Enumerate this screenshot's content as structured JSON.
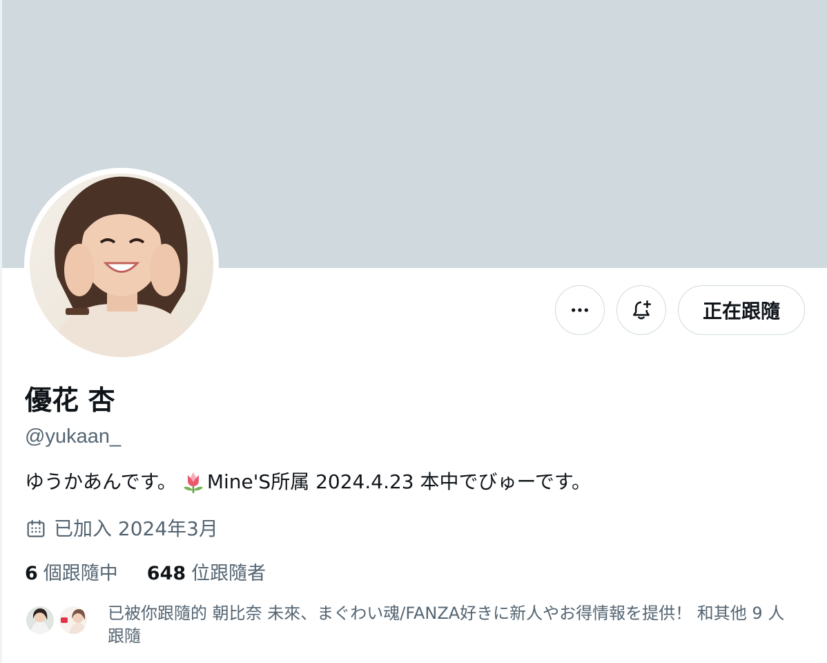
{
  "profile": {
    "display_name": "優花 杏",
    "handle": "@yukaan_",
    "bio_before": "ゆうかあんです。",
    "bio_emoji": "tulip-icon",
    "bio_after": "Mine'S所属 2024.4.23 本中でびゅーです。",
    "joined": "已加入 2024年3月"
  },
  "actions": {
    "more_icon": "more-icon",
    "notify_icon": "bell-plus-icon",
    "follow_label": "正在跟隨"
  },
  "stats": {
    "following_count": "6",
    "following_label": "個跟隨中",
    "followers_count": "648",
    "followers_label": "位跟隨者"
  },
  "mutuals": {
    "text": "已被你跟隨的 朝比奈 未來、まぐわい魂/FANZA好きに新人やお得情報を提供！ 和其他 9 人跟隨"
  },
  "colors": {
    "banner": "#cfd9de",
    "text_primary": "#0f1419",
    "text_secondary": "#536471",
    "border": "#cfd9de"
  }
}
